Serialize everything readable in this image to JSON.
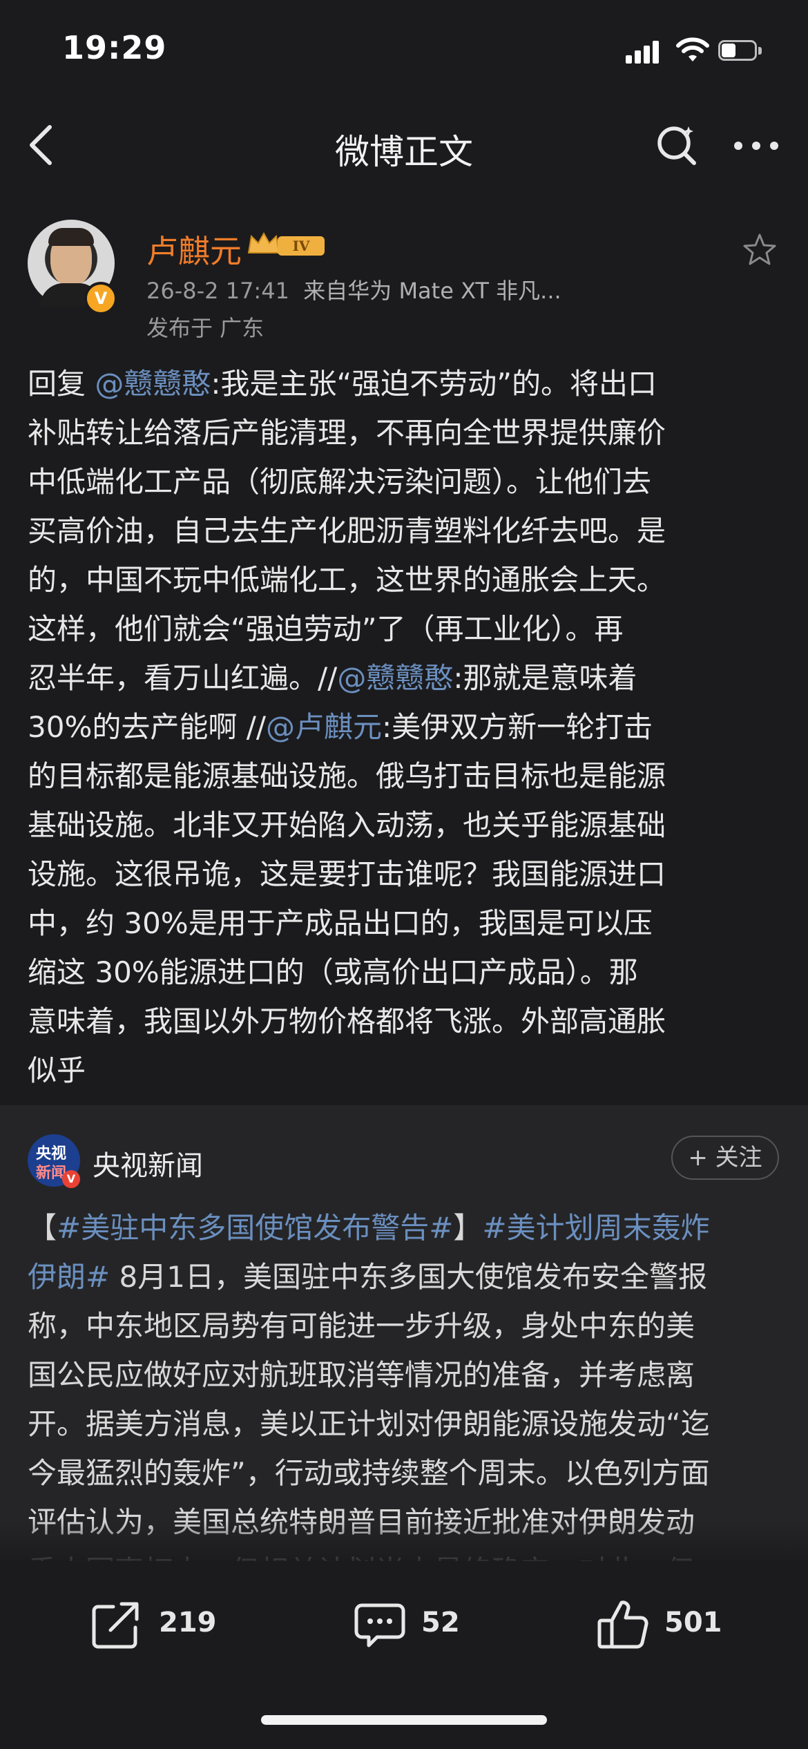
{
  "status_bar": {
    "time": "19:29"
  },
  "nav": {
    "title": "微博正文"
  },
  "post": {
    "author": "卢麒元",
    "level": "IV",
    "timestamp": "26-8-2 17:41",
    "source": "来自华为 Mate XT 非凡...",
    "location": "发布于 广东",
    "body_lines": [
      [
        {
          "t": "回复 "
        },
        {
          "t": "@戆戆憨",
          "link": true
        },
        {
          "t": ":我是主张“强迫不劳动”的。将出口"
        }
      ],
      [
        {
          "t": "补贴转让给落后产能清理，不再向全世界提供廉价"
        }
      ],
      [
        {
          "t": "中低端化工产品（彻底解决污染问题）。让他们去"
        }
      ],
      [
        {
          "t": "买高价油，自己去生产化肥沥青塑料化纤去吧。是"
        }
      ],
      [
        {
          "t": "的，中国不玩中低端化工，这世界的通胀会上天。"
        }
      ],
      [
        {
          "t": "这样，他们就会“强迫劳动”了（再工业化）。再"
        }
      ],
      [
        {
          "t": "忍半年，看万山红遍。//"
        },
        {
          "t": "@戆戆憨",
          "link": true
        },
        {
          "t": ":那就是意味着"
        }
      ],
      [
        {
          "t": "30%的去产能啊 //"
        },
        {
          "t": "@卢麒元",
          "link": true
        },
        {
          "t": ":美伊双方新一轮打击"
        }
      ],
      [
        {
          "t": "的目标都是能源基础设施。俄乌打击目标也是能源"
        }
      ],
      [
        {
          "t": "基础设施。北非又开始陷入动荡，也关乎能源基础"
        }
      ],
      [
        {
          "t": "设施。这很吊诡，这是要打击谁呢？我国能源进口"
        }
      ],
      [
        {
          "t": "中，约 30%是用于产成品出口的，我国是可以压"
        }
      ],
      [
        {
          "t": "缩这 30%能源进口的（或高价出口产成品）。那"
        }
      ],
      [
        {
          "t": "意味着，我国以外万物价格都将飞涨。外部高通胀"
        }
      ],
      [
        {
          "t": "似乎"
        }
      ]
    ]
  },
  "repost": {
    "logo_top": "央视",
    "logo_bottom": "新闻",
    "source_name": "央视新闻",
    "follow_label": "+ 关注",
    "body_lines": [
      [
        {
          "t": "【"
        },
        {
          "t": "#美驻中东多国使馆发布警告#",
          "link": true
        },
        {
          "t": "】"
        },
        {
          "t": "#美计划周末轰炸",
          "link": true
        }
      ],
      [
        {
          "t": "伊朗#",
          "link": true
        },
        {
          "t": " 8月1日，美国驻中东多国大使馆发布安全警报"
        }
      ],
      [
        {
          "t": "称，中东地区局势有可能进一步升级，身处中东的美"
        }
      ],
      [
        {
          "t": "国公民应做好应对航班取消等情况的准备，并考虑离"
        }
      ],
      [
        {
          "t": "开。据美方消息，美以正计划对伊朗能源设施发动“迄"
        }
      ],
      [
        {
          "t": "今最猛烈的轰炸”，行动或持续整个周末。以色列方面"
        }
      ],
      [
        {
          "t": "评估认为，美国总统特朗普目前接近批准对伊朗发动"
        }
      ],
      [
        {
          "t": "重大军事打击，但相关计划尚未最终确定。对此，伊"
        }
      ]
    ]
  },
  "actions": {
    "repost_count": "219",
    "comment_count": "52",
    "like_count": "501"
  },
  "colors": {
    "background": "#1b1b1d",
    "card": "#252527",
    "author_name": "#f07c2a",
    "link": "#6b8fbf"
  }
}
